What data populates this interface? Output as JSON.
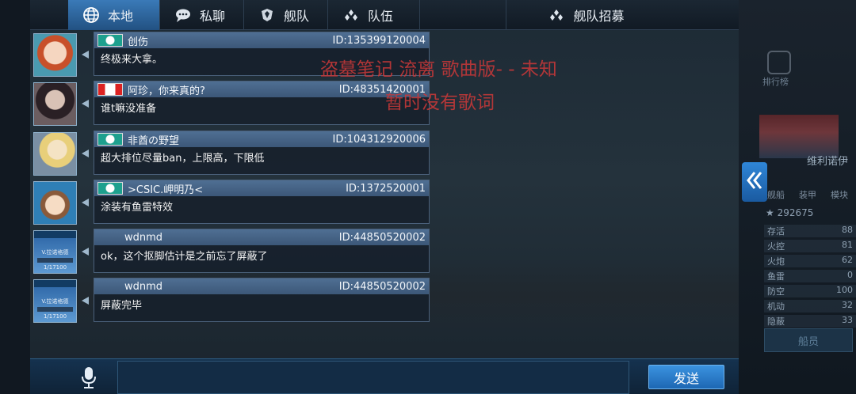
{
  "tabs": [
    {
      "label": "本地",
      "icon": "globe-icon",
      "active": true
    },
    {
      "label": "私聊",
      "icon": "chat-bubble-icon",
      "active": false
    },
    {
      "label": "舰队",
      "icon": "fleet-shield-icon",
      "active": false
    },
    {
      "label": "队伍",
      "icon": "team-dots-icon",
      "active": false
    },
    {
      "label": "舰队招募",
      "icon": "team-dots-icon",
      "active": false
    }
  ],
  "messages": [
    {
      "name": "创伤",
      "uid": "ID:135399120004",
      "text": "终极来大拿。",
      "badge": "green",
      "avatar": "anime-girl-red-hair"
    },
    {
      "name": "阿珍，你来真的?",
      "uid": "ID:48351420001",
      "text": "谁t嘛没准备",
      "badge": "canada-flag",
      "avatar": "dark-hair-girl"
    },
    {
      "name": "非酋の野望",
      "uid": "ID:104312920006",
      "text": "超大排位尽量ban，上限高，下限低",
      "badge": "green",
      "avatar": "blonde-anime-girl"
    },
    {
      "name": ">CSIC.岬明乃<",
      "uid": "ID:1372520001",
      "text": "涂装有鱼雷特效",
      "badge": "green",
      "avatar": "captain-girl"
    },
    {
      "name": "wdnmd",
      "uid": "ID:44850520002",
      "text": "ok，这个抠脚估计是之前忘了屏蔽了",
      "badge": "none",
      "avatar": "ship-card"
    },
    {
      "name": "wdnmd",
      "uid": "ID:44850520002",
      "text": "屏蔽完毕",
      "badge": "none",
      "avatar": "ship-card"
    }
  ],
  "ship_card": {
    "name": "V.拉诺格德",
    "level": "1/17100"
  },
  "song_overlay": {
    "line1": "盗墓笔记 流离 歌曲版- - 未知",
    "line2": "暂时没有歌词"
  },
  "right_panel": {
    "ship_name": "维利诺伊",
    "tabs": [
      "舰船",
      "装甲",
      "模块"
    ],
    "rank_label": "排行榜",
    "score": "292675",
    "stats": [
      {
        "label": "存活",
        "value": "88"
      },
      {
        "label": "火控",
        "value": "81"
      },
      {
        "label": "火炮",
        "value": "62"
      },
      {
        "label": "鱼雷",
        "value": "0"
      },
      {
        "label": "防空",
        "value": "100"
      },
      {
        "label": "机动",
        "value": "32"
      },
      {
        "label": "隐蔽",
        "value": "33"
      }
    ],
    "crew_label": "船员"
  },
  "input": {
    "placeholder": "",
    "send_label": "发送"
  }
}
